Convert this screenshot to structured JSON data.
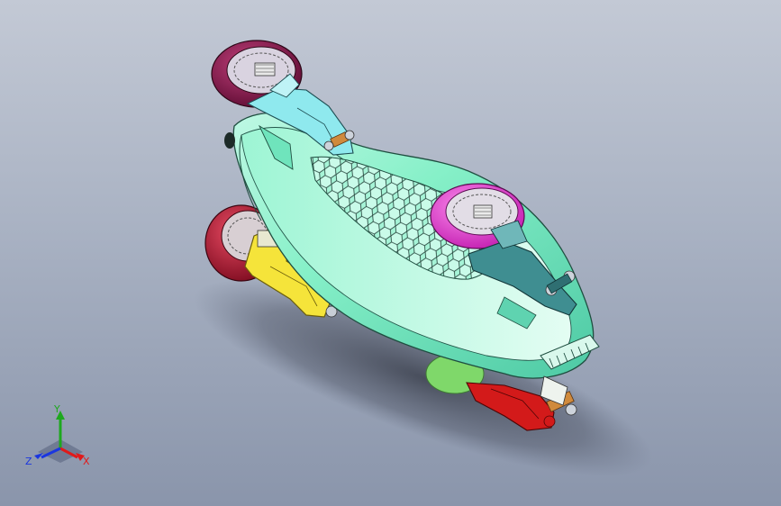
{
  "viewport": {
    "background_top": "#c3c9d5",
    "background_bottom": "#8a95ab"
  },
  "model": {
    "body_color": "#7ff0c4",
    "body_dark": "#3fc39c",
    "bracket_rear_color": "#8fe9ee",
    "bracket_front_right_color": "#3f8e91",
    "wheel_front_left_color": "#8c1a4c",
    "wheel_front_right_color": "#e43fd1",
    "wheel_rear_left_color": "#b51d39",
    "wheel_rear_right_color": "#7fd86a",
    "bracket_yellow_color": "#f5e43a",
    "bracket_red_color": "#d31a1a",
    "pin_color": "#d08a3c"
  },
  "triad": {
    "x_label": "X",
    "y_label": "Y",
    "z_label": "Z",
    "x_color": "#e01a1a",
    "y_color": "#1ea81e",
    "z_color": "#1a36e0"
  }
}
